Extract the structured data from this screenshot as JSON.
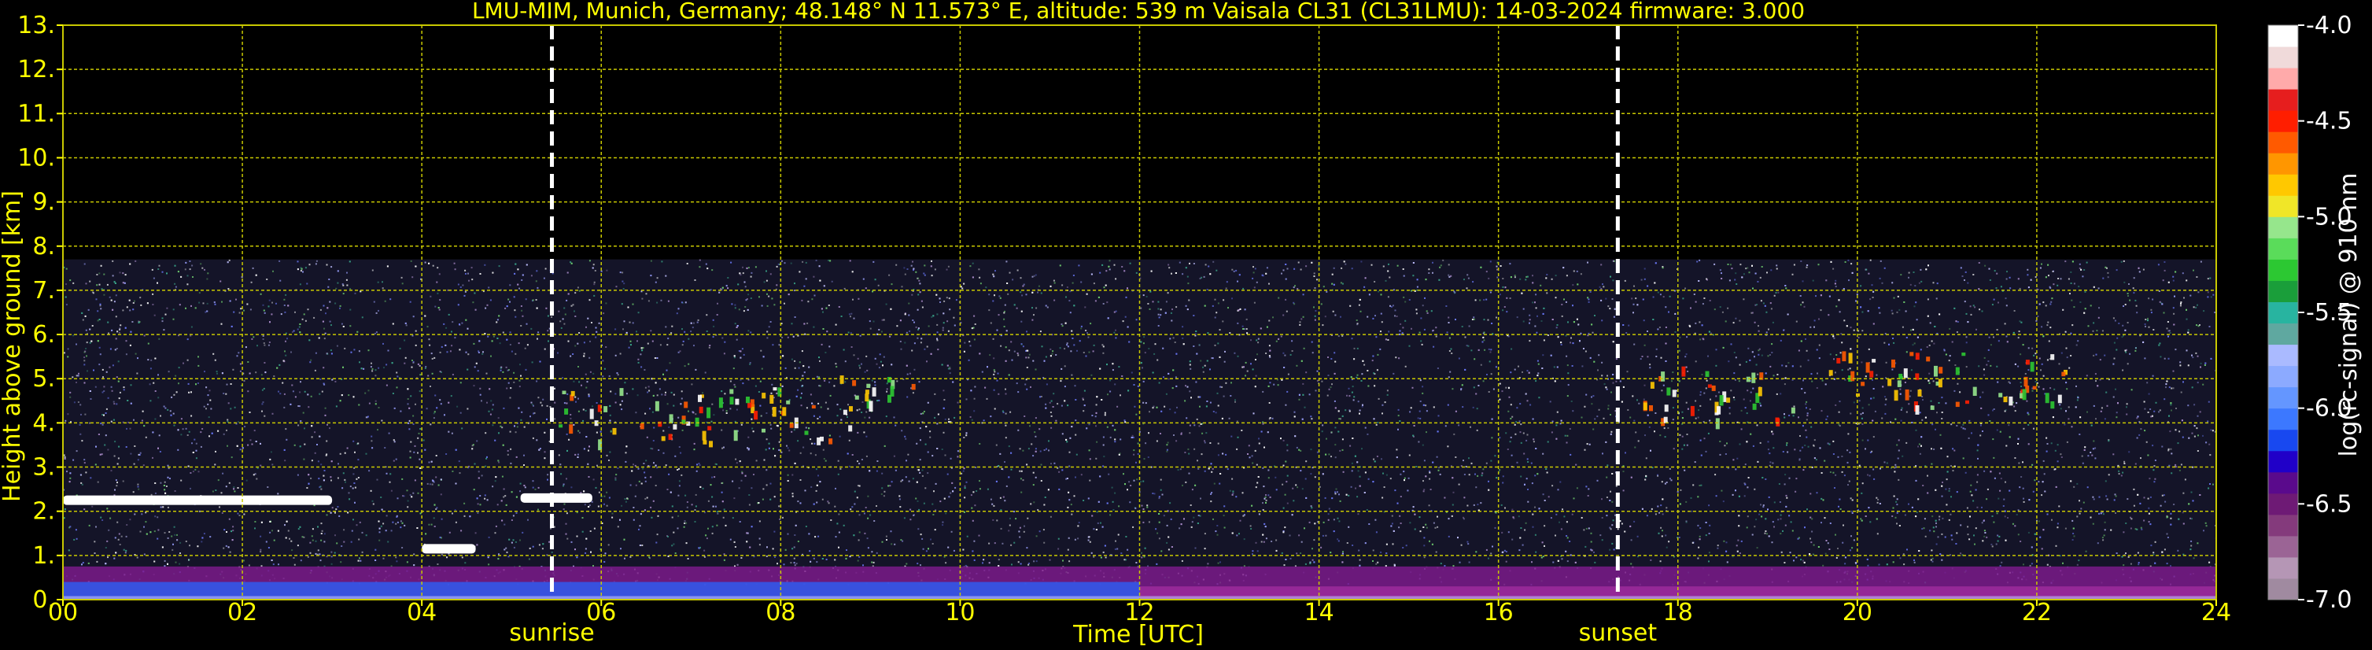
{
  "chart_data": {
    "type": "heatmap",
    "title": "LMU-MIM, Munich, Germany; 48.148° N 11.573° E, altitude: 539 m    Vaisala CL31 (CL31LMU): 14-03-2024    firmware: 3.000",
    "xlabel": "Time [UTC]",
    "ylabel": "Height above ground [km]",
    "xlim": [
      0,
      24
    ],
    "ylim": [
      0,
      13
    ],
    "x_ticks": [
      "00",
      "02",
      "04",
      "06",
      "08",
      "10",
      "12",
      "14",
      "16",
      "18",
      "20",
      "22",
      "24"
    ],
    "y_ticks": [
      "0.",
      "1.",
      "2.",
      "3.",
      "4.",
      "5.",
      "6.",
      "7.",
      "8.",
      "9.",
      "10.",
      "11.",
      "12.",
      "13."
    ],
    "grid": true,
    "data_top_km": 7.7,
    "colorbar": {
      "label": "log(rc-signal) @ 910 nm",
      "range": [
        -7.0,
        -4.0
      ],
      "ticks": [
        "-4.0",
        "-4.5",
        "-5.0",
        "-5.5",
        "-6.0",
        "-6.5",
        "-7.0"
      ],
      "colors": [
        "#a08aa0",
        "#b596b5",
        "#9b6495",
        "#843a7c",
        "#6e1a75",
        "#5a0a8c",
        "#2000c8",
        "#1848f0",
        "#3c78ff",
        "#6496ff",
        "#8caaff",
        "#aabaff",
        "#5fa8a0",
        "#28b4a0",
        "#1a9e3a",
        "#2cc832",
        "#5adc5a",
        "#96e68c",
        "#f0e628",
        "#ffc800",
        "#ff9600",
        "#ff5a00",
        "#ff1e00",
        "#e61e1e",
        "#ffaaaa",
        "#f0dada",
        "#ffffff"
      ]
    },
    "vertical_markers": [
      {
        "label": "sunrise",
        "x": 5.45
      },
      {
        "label": "sunset",
        "x": 17.33
      }
    ],
    "features": [
      {
        "name": "low cloud layer",
        "x_range": [
          0.0,
          3.0
        ],
        "height_km": 2.25
      },
      {
        "name": "low cloud patch",
        "x_range": [
          4.0,
          4.6
        ],
        "height_km": 1.15
      },
      {
        "name": "low cloud patch",
        "x_range": [
          5.1,
          5.9
        ],
        "height_km": 2.3
      },
      {
        "name": "mid-level cloud",
        "x_range": [
          5.5,
          8.6
        ],
        "height_km": 4.2
      },
      {
        "name": "mid-level cloud",
        "x_range": [
          8.6,
          9.5
        ],
        "height_km": 4.5
      },
      {
        "name": "mid-level cloud",
        "x_range": [
          17.6,
          19.3
        ],
        "height_km": 4.7
      },
      {
        "name": "mid-level cloud",
        "x_range": [
          19.5,
          22.3
        ],
        "height_km": 5.0
      },
      {
        "name": "boundary layer aerosol",
        "x_range": [
          0,
          24
        ],
        "height_km": 0.5
      }
    ]
  }
}
